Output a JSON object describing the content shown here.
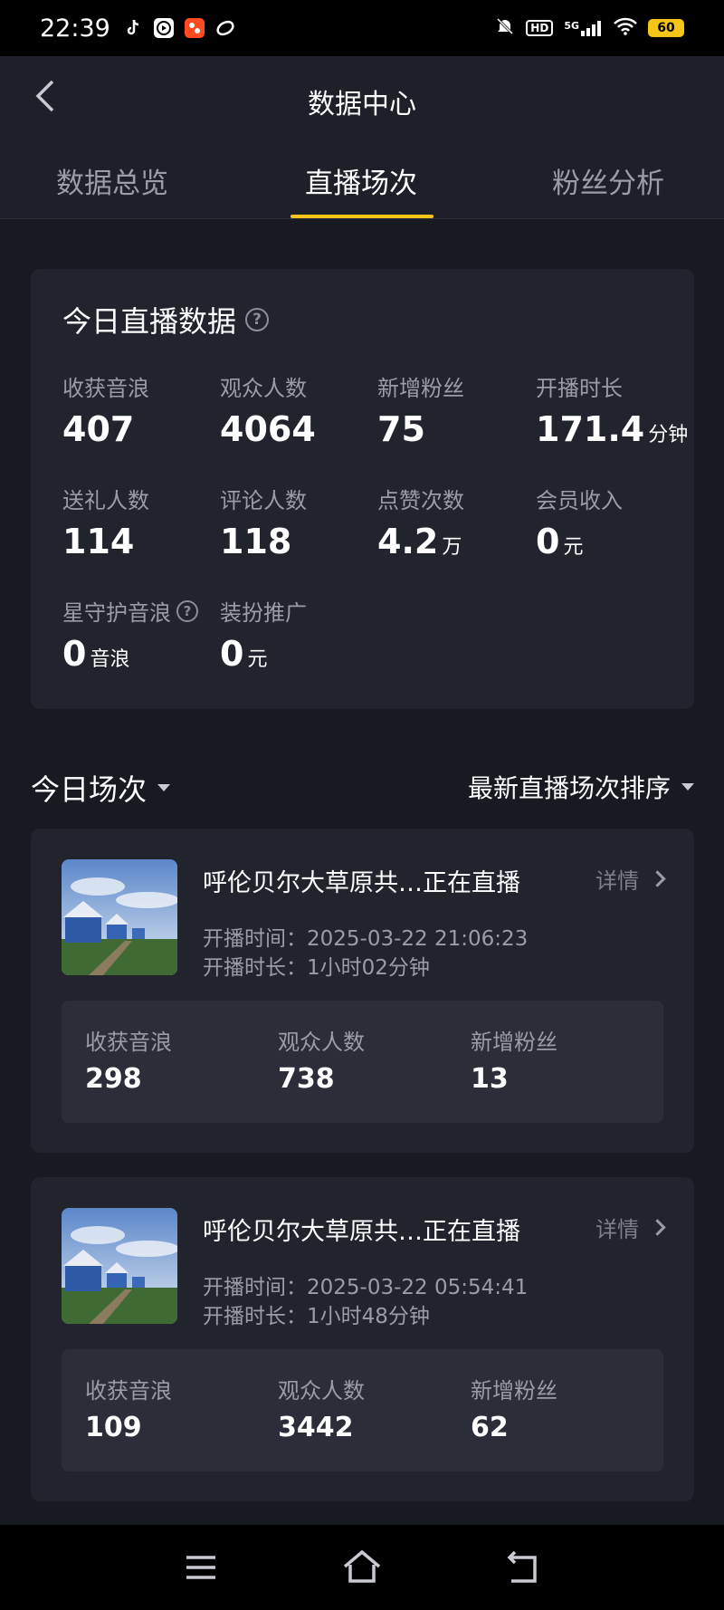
{
  "status_bar": {
    "time": "22:39",
    "network": "5G",
    "hd": "HD",
    "battery": "60",
    "app_icons": [
      "tiktok-icon",
      "video-app-icon",
      "red-app-icon",
      "link-app-icon"
    ]
  },
  "header": {
    "title": "数据中心"
  },
  "tabs": [
    {
      "label": "数据总览",
      "active": false
    },
    {
      "label": "直播场次",
      "active": true
    },
    {
      "label": "粉丝分析",
      "active": false
    }
  ],
  "today": {
    "title": "今日直播数据",
    "metrics": [
      {
        "label": "收获音浪",
        "value": "407",
        "unit": ""
      },
      {
        "label": "观众人数",
        "value": "4064",
        "unit": ""
      },
      {
        "label": "新增粉丝",
        "value": "75",
        "unit": ""
      },
      {
        "label": "开播时长",
        "value": "171.4",
        "unit": "分钟"
      },
      {
        "label": "送礼人数",
        "value": "114",
        "unit": ""
      },
      {
        "label": "评论人数",
        "value": "118",
        "unit": ""
      },
      {
        "label": "点赞次数",
        "value": "4.2",
        "unit": "万"
      },
      {
        "label": "会员收入",
        "value": "0",
        "unit": "元"
      },
      {
        "label": "星守护音浪",
        "value": "0",
        "unit": "音浪"
      },
      {
        "label": "装扮推广",
        "value": "0",
        "unit": "元"
      }
    ]
  },
  "sessions": {
    "title": "今日场次",
    "sort_label": "最新直播场次排序",
    "items": [
      {
        "title": "呼伦贝尔大草原共…正在直播",
        "detail": "详情",
        "start_time": "开播时间：2025-03-22 21:06:23",
        "duration": "开播时长：1小时02分钟",
        "stats": [
          {
            "label": "收获音浪",
            "value": "298"
          },
          {
            "label": "观众人数",
            "value": "738"
          },
          {
            "label": "新增粉丝",
            "value": "13"
          }
        ]
      },
      {
        "title": "呼伦贝尔大草原共…正在直播",
        "detail": "详情",
        "start_time": "开播时间：2025-03-22 05:54:41",
        "duration": "开播时长：1小时48分钟",
        "stats": [
          {
            "label": "收获音浪",
            "value": "109"
          },
          {
            "label": "观众人数",
            "value": "3442"
          },
          {
            "label": "新增粉丝",
            "value": "62"
          }
        ]
      }
    ]
  },
  "colors": {
    "background": "#181a21",
    "card": "#21232d",
    "accent": "#f5c518",
    "muted_text": "#9a9ca6"
  }
}
